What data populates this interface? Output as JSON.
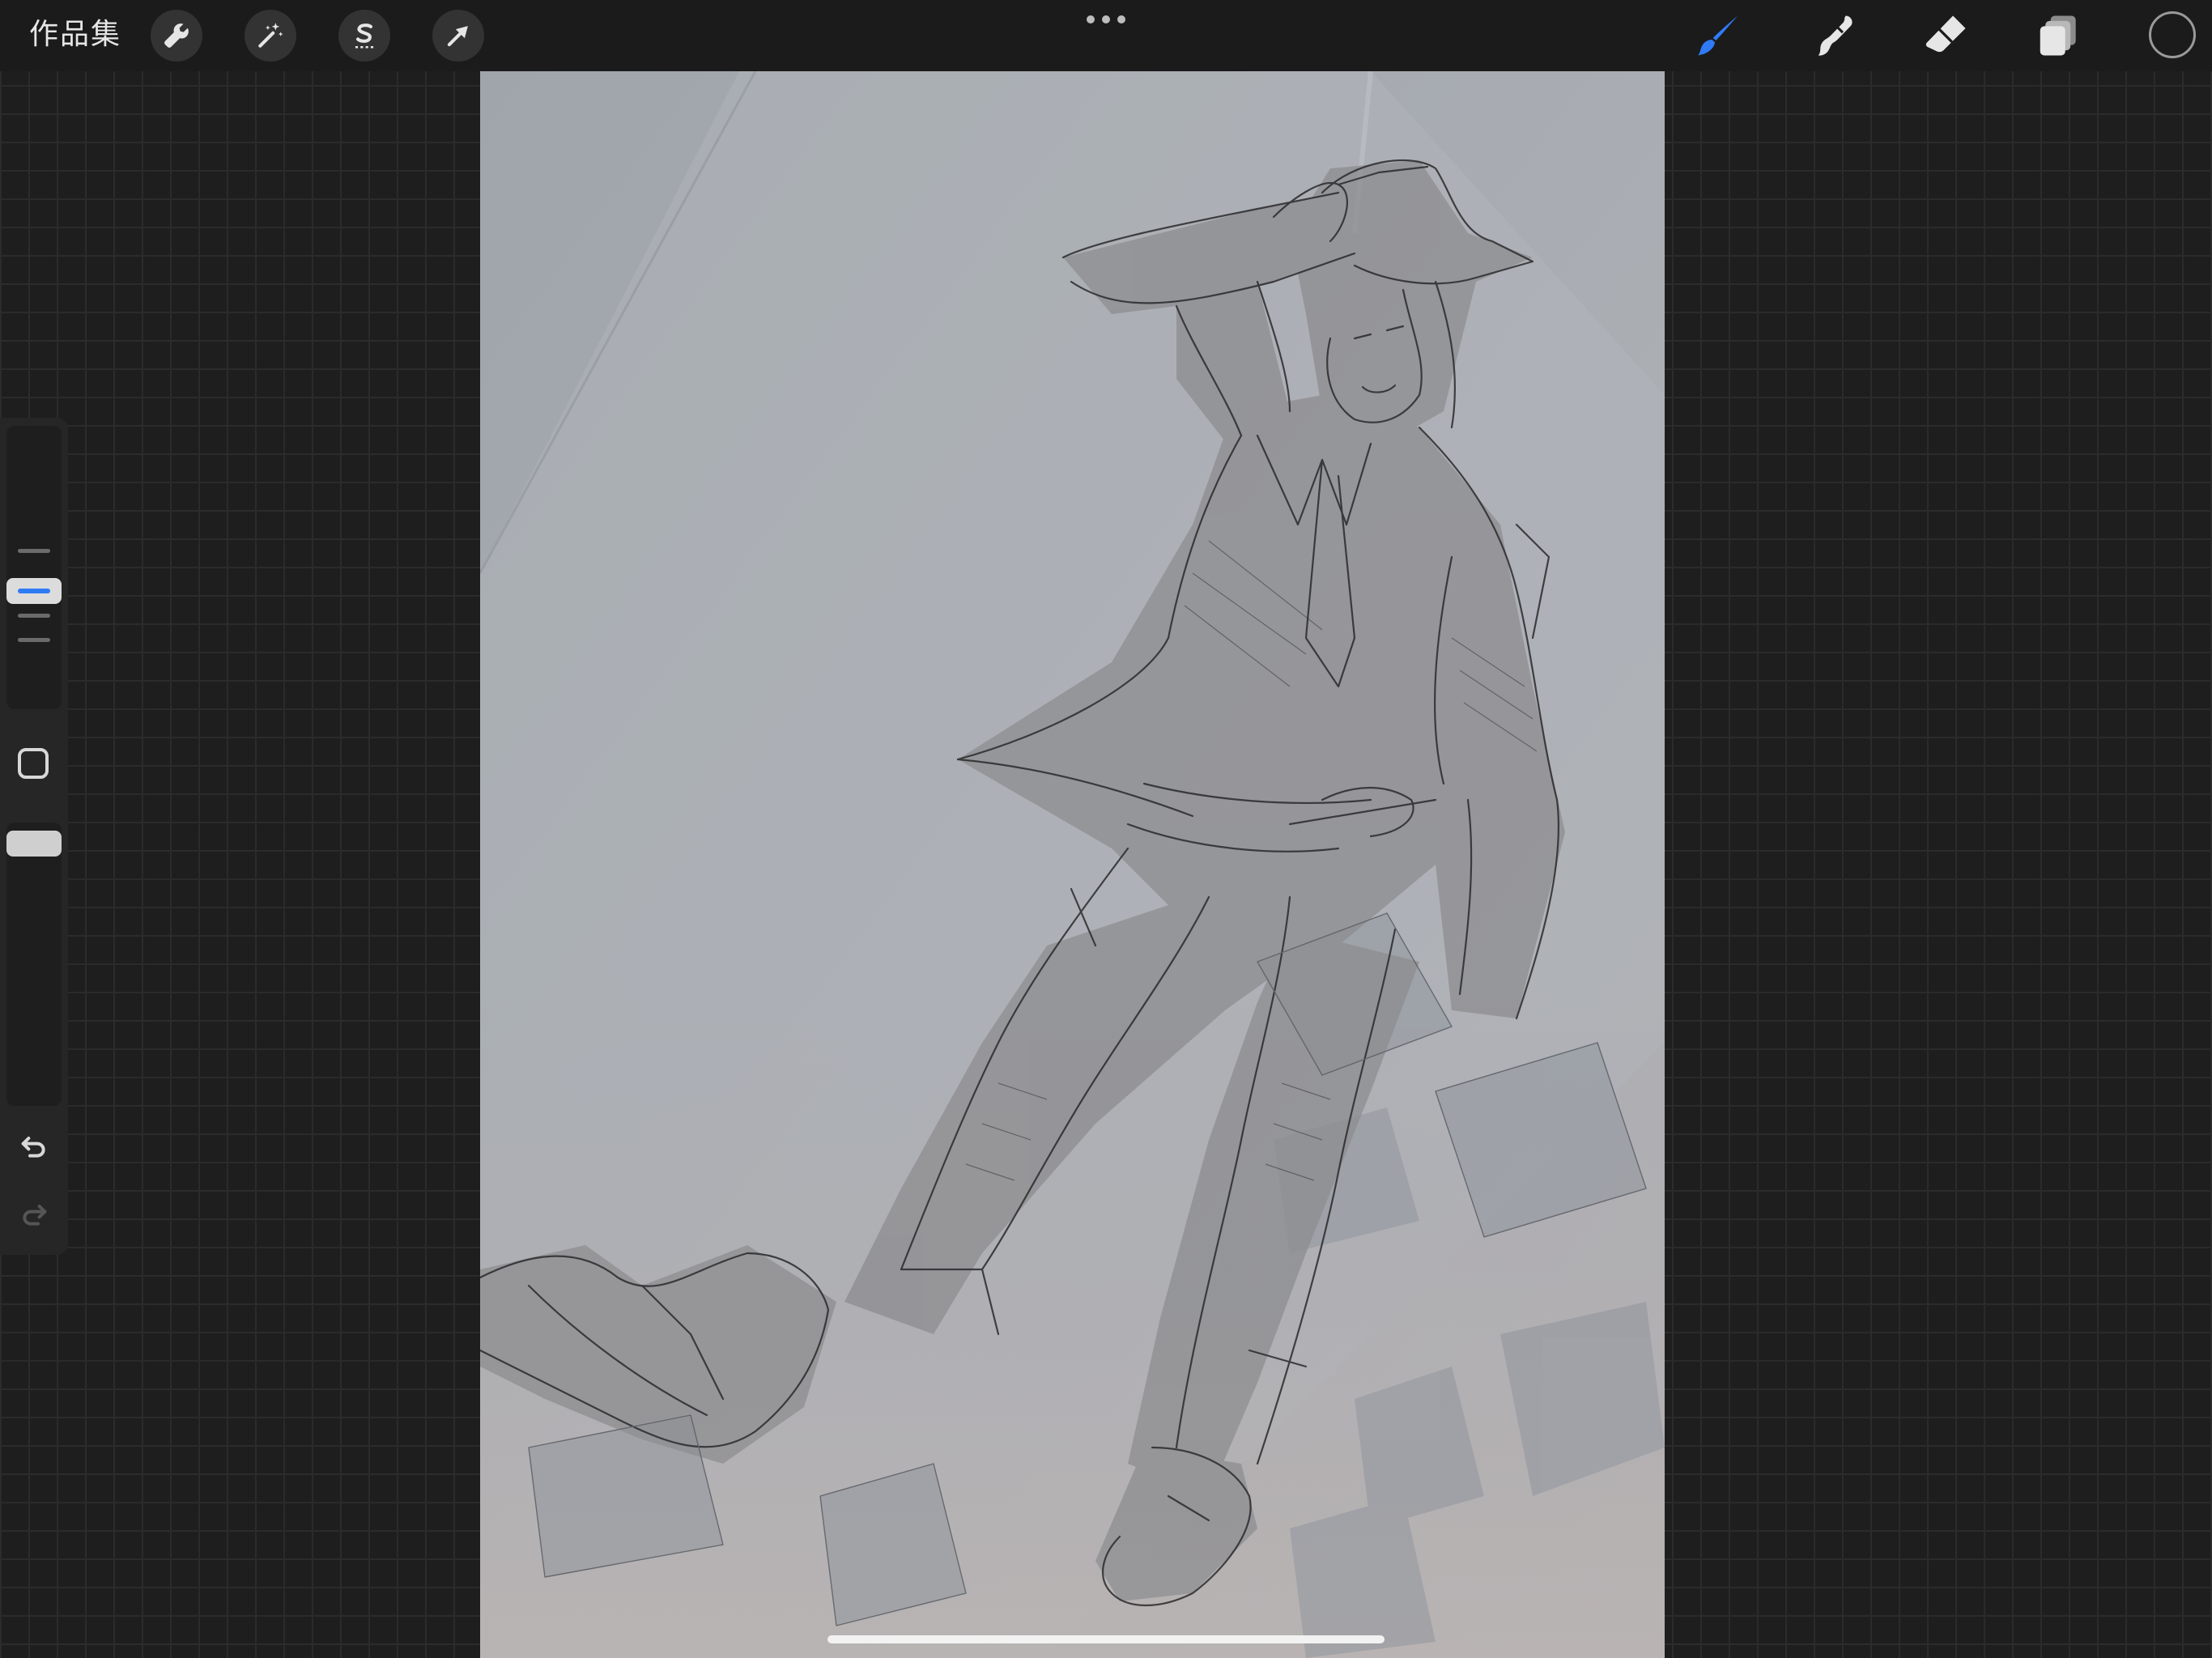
{
  "topbar": {
    "gallery_label": "作品集",
    "left_tools": [
      {
        "name": "actions",
        "icon": "wrench-icon"
      },
      {
        "name": "adjustments",
        "icon": "magic-wand-icon"
      },
      {
        "name": "selection",
        "icon": "selection-s-icon"
      },
      {
        "name": "transform",
        "icon": "arrow-cursor-icon"
      }
    ],
    "more_icon": "ellipsis-icon",
    "right_tools": [
      {
        "name": "paint",
        "icon": "brush-icon",
        "active": true
      },
      {
        "name": "smudge",
        "icon": "smudge-finger-icon",
        "active": false
      },
      {
        "name": "erase",
        "icon": "eraser-icon",
        "active": false
      },
      {
        "name": "layers",
        "icon": "layers-icon",
        "active": false
      }
    ],
    "current_color": "#1b1b1b"
  },
  "sidebar": {
    "brush_size_icon": "size-slider",
    "modify_icon": "square-icon",
    "opacity_icon": "opacity-slider",
    "undo_icon": "undo-icon",
    "redo_icon": "redo-icon"
  },
  "colors": {
    "accent": "#2f7bf5",
    "bar_bg": "#1b1b1b",
    "canvas_bg": "#a4a9ae"
  }
}
